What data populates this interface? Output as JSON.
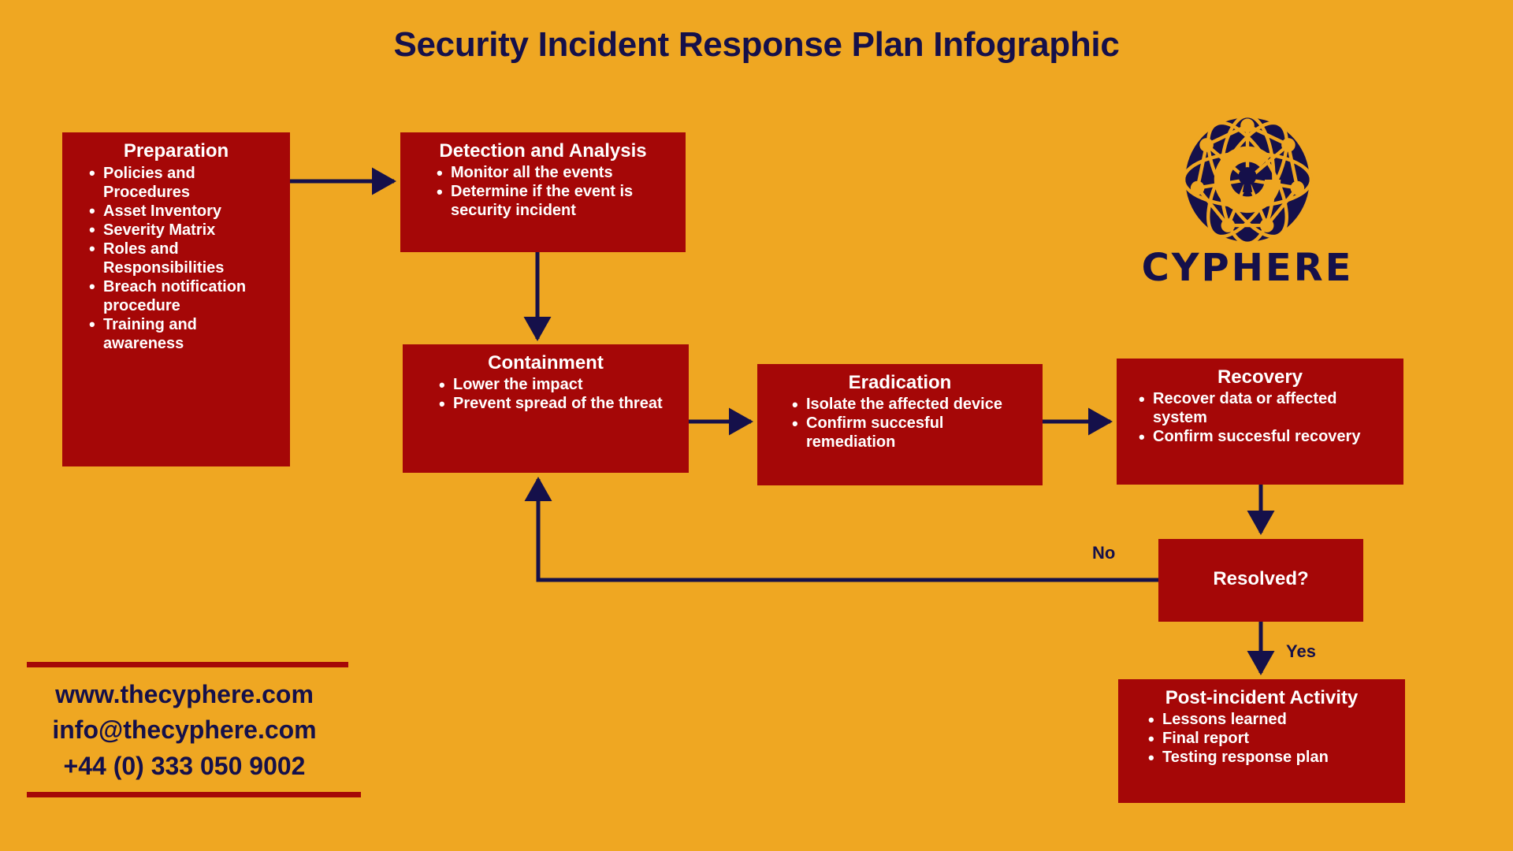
{
  "page": {
    "title": "Security Incident Response Plan Infographic",
    "background_color": "#EFA722",
    "box_color": "#A50707",
    "ink_color": "#15104A",
    "box_text_color": "#FFFFFF"
  },
  "flow": {
    "preparation": {
      "title": "Preparation",
      "items": [
        "Policies and Procedures",
        "Asset Inventory",
        "Severity Matrix",
        "Roles and Responsibilities",
        "Breach notification procedure",
        "Training and awareness"
      ]
    },
    "detection": {
      "title": "Detection and Analysis",
      "items": [
        "Monitor all the events",
        "Determine if the event is security incident"
      ]
    },
    "containment": {
      "title": "Containment",
      "items": [
        "Lower the impact",
        "Prevent spread of the threat"
      ]
    },
    "eradication": {
      "title": "Eradication",
      "items": [
        "Isolate the affected device",
        "Confirm succesful remediation"
      ]
    },
    "recovery": {
      "title": "Recovery",
      "items": [
        "Recover data or affected system",
        "Confirm succesful recovery"
      ]
    },
    "resolved": {
      "title": "Resolved?"
    },
    "post_incident": {
      "title": "Post-incident Activity",
      "items": [
        "Lessons learned",
        "Final report",
        "Testing response plan"
      ]
    }
  },
  "edge_labels": {
    "no": "No",
    "yes": "Yes"
  },
  "brand": {
    "wordmark": "CYPHERE",
    "logo_icon": "cyphere-network-globe-lock-icon"
  },
  "contact": {
    "website": "www.thecyphere.com",
    "email": "info@thecyphere.com",
    "phone": "+44 (0) 333 050 9002"
  }
}
